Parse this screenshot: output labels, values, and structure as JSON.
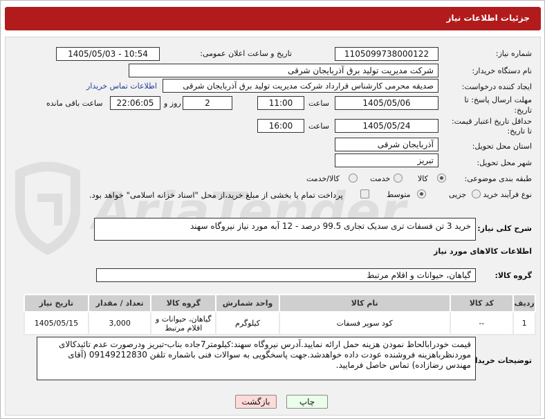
{
  "header": {
    "title": "جزئیات اطلاعات نیاز"
  },
  "form": {
    "need_number_label": "شماره نیاز:",
    "need_number": "1105099738000122",
    "announce_label": "تاریخ و ساعت اعلان عمومی:",
    "announce_value": "1405/05/03 - 10:54",
    "buyer_org_label": "نام دستگاه خریدار:",
    "buyer_org": "شرکت مدیریت تولید برق آذربایجان شرقی",
    "requester_label": "ایجاد کننده درخواست:",
    "requester": "صدیقه محرمی کارشناس قرارداد شرکت مدیریت تولید برق آذربایجان شرقی",
    "buyer_contact_link": "اطلاعات تماس خریدار",
    "deadline_label_1": "مهلت ارسال پاسخ: تا",
    "deadline_label_2": "تاریخ:",
    "deadline_date": "1405/05/06",
    "time_label": "ساعت",
    "deadline_time": "11:00",
    "days_value": "2",
    "days_label": "روز و",
    "remaining_time": "22:06:05",
    "remaining_label": "ساعت باقی مانده",
    "validity_label_1": "حداقل تاریخ اعتبار قیمت:",
    "validity_label_2": "تا تاریخ:",
    "validity_date": "1405/05/24",
    "validity_time": "16:00",
    "province_label": "استان محل تحویل:",
    "province": "آذربایجان شرقی",
    "city_label": "شهر محل تحویل:",
    "city": "تبریز",
    "category_label": "طبقه بندی موضوعی:",
    "category_options": [
      "کالا",
      "خدمت",
      "کالا/خدمت"
    ],
    "process_label": "نوع فرآیند خرید :",
    "process_options": [
      "جزیی",
      "متوسط"
    ],
    "payment_note": "پرداخت تمام یا بخشی از مبلغ خرید،از محل \"اسناد خزانه اسلامی\" خواهد بود."
  },
  "description": {
    "label": "شرح کلی نیاز:",
    "text": "خرید 3 تن فسفات تری سدیک تجاری 99.5 درصد  -  12 آبه مورد نیاز نیروگاه سهند"
  },
  "goods": {
    "section_title": "اطلاعات کالاهای مورد نیاز",
    "group_label": "گروه کالا:",
    "group_value": "گیاهان، حیوانات و اقلام مرتبط",
    "columns": [
      "ردیف",
      "کد کالا",
      "نام کالا",
      "واحد شمارش",
      "گروه کالا",
      "تعداد / مقدار",
      "تاریخ نیاز"
    ],
    "rows": [
      {
        "row": "1",
        "code": "--",
        "name": "کود سوپر فسفات",
        "unit": "کیلوگرم",
        "group": "گیاهان، حیوانات و اقلام مرتبط",
        "qty": "3,000",
        "date": "1405/05/15"
      }
    ]
  },
  "buyer_notes": {
    "label": "توضیحات خریدار:",
    "text": "قیمت خودرابالحاظ نمودن هزینه حمل ارائه نمایید.آدرس نیروگاه سهند:کیلومتر7جاده بناب-تبریز ودرصورت عدم تائیدکالای موردنظرباهزینه فروشنده عودت داده خواهدشد.جهت پاسخگویی به سوالات فنی باشماره تلفن 09149212830 (آقای مهندس رضازاده) تماس حاصل فرمایید."
  },
  "buttons": {
    "print": "چاپ",
    "back": "بازگشت"
  },
  "watermark": {
    "text": "AriaTender.neT",
    "color": "#c9c9c9"
  }
}
